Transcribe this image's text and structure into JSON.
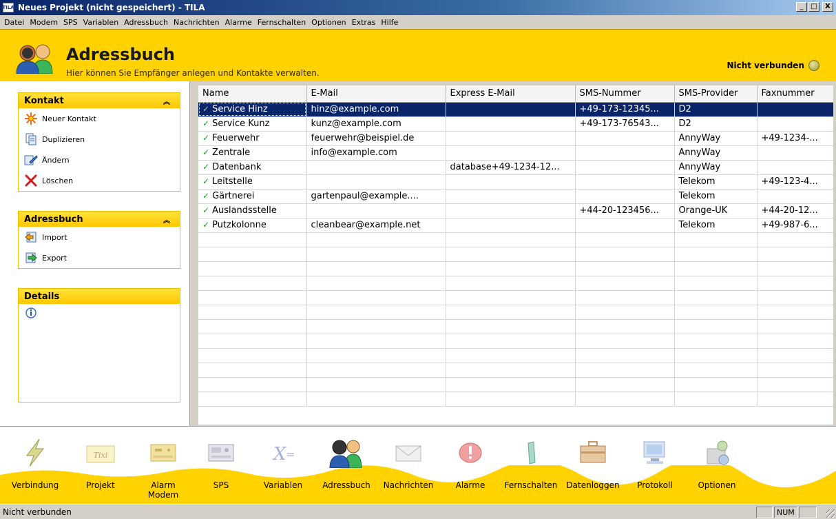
{
  "window": {
    "title": "Neues Projekt (nicht gespeichert) - TILA",
    "app_icon_text": "TILA",
    "minimize": "_",
    "maximize": "□",
    "close": "X"
  },
  "menu": [
    "Datei",
    "Modem",
    "SPS",
    "Variablen",
    "Adressbuch",
    "Nachrichten",
    "Alarme",
    "Fernschalten",
    "Optionen",
    "Extras",
    "Hilfe"
  ],
  "header": {
    "title": "Adressbuch",
    "subtitle": "Hier können Sie Empfänger anlegen und Kontakte verwalten.",
    "connection_status": "Nicht verbunden"
  },
  "sidebar": {
    "kontakt": {
      "title": "Kontakt",
      "items": [
        {
          "label": "Neuer Kontakt",
          "icon": "new-contact-icon"
        },
        {
          "label": "Duplizieren",
          "icon": "duplicate-icon"
        },
        {
          "label": "Ändern",
          "icon": "edit-icon"
        },
        {
          "label": "Löschen",
          "icon": "delete-icon"
        }
      ]
    },
    "adressbuch": {
      "title": "Adressbuch",
      "items": [
        {
          "label": "Import",
          "icon": "import-icon"
        },
        {
          "label": "Export",
          "icon": "export-icon"
        }
      ]
    },
    "details": {
      "title": "Details",
      "icon": "info-icon"
    }
  },
  "table": {
    "columns": [
      "Name",
      "E-Mail",
      "Express E-Mail",
      "SMS-Nummer",
      "SMS-Provider",
      "Faxnummer"
    ],
    "rows": [
      {
        "name": "Service Hinz",
        "email": "hinz@example.com",
        "express": "",
        "sms": "+49-173-12345...",
        "provider": "D2",
        "fax": "",
        "selected": true
      },
      {
        "name": "Service Kunz",
        "email": "kunz@example.com",
        "express": "",
        "sms": "+49-173-76543...",
        "provider": "D2",
        "fax": "",
        "selected": false
      },
      {
        "name": "Feuerwehr",
        "email": "feuerwehr@beispiel.de",
        "express": "",
        "sms": "",
        "provider": "AnnyWay",
        "fax": "+49-1234-...",
        "selected": false
      },
      {
        "name": "Zentrale",
        "email": "info@example.com",
        "express": "",
        "sms": "",
        "provider": "AnnyWay",
        "fax": "",
        "selected": false
      },
      {
        "name": "Datenbank",
        "email": "",
        "express": "database+49-1234-12...",
        "sms": "",
        "provider": "AnnyWay",
        "fax": "",
        "selected": false
      },
      {
        "name": "Leitstelle",
        "email": "",
        "express": "",
        "sms": "",
        "provider": "Telekom",
        "fax": "+49-123-4...",
        "selected": false
      },
      {
        "name": "Gärtnerei",
        "email": "gartenpaul@example....",
        "express": "",
        "sms": "",
        "provider": "Telekom",
        "fax": "",
        "selected": false
      },
      {
        "name": "Auslandsstelle",
        "email": "",
        "express": "",
        "sms": "+44-20-123456...",
        "provider": "Orange-UK",
        "fax": "+44-20-12...",
        "selected": false
      },
      {
        "name": "Putzkolonne",
        "email": "cleanbear@example.net",
        "express": "",
        "sms": "",
        "provider": "Telekom",
        "fax": "+49-987-6...",
        "selected": false
      }
    ],
    "empty_rows": 12
  },
  "bottom_nav": [
    {
      "label": "Verbindung",
      "icon": "lightning-icon",
      "active": false
    },
    {
      "label": "Projekt",
      "icon": "tixi-project-icon",
      "active": false
    },
    {
      "label": "Alarm Modem",
      "icon": "alarm-modem-icon",
      "active": false
    },
    {
      "label": "SPS",
      "icon": "plc-icon",
      "active": false
    },
    {
      "label": "Variablen",
      "icon": "variables-icon",
      "active": false
    },
    {
      "label": "Adressbuch",
      "icon": "address-book-icon",
      "active": true
    },
    {
      "label": "Nachrichten",
      "icon": "envelope-icon",
      "active": false
    },
    {
      "label": "Alarme",
      "icon": "alarm-icon",
      "active": false
    },
    {
      "label": "Fernschalten",
      "icon": "remote-switch-icon",
      "active": false
    },
    {
      "label": "Datenloggen",
      "icon": "briefcase-icon",
      "active": false
    },
    {
      "label": "Protokoll",
      "icon": "monitor-icon",
      "active": false
    },
    {
      "label": "Optionen",
      "icon": "options-icon",
      "active": false
    }
  ],
  "statusbar": {
    "text": "Nicht verbunden",
    "num": "NUM"
  },
  "colors": {
    "accent_yellow": "#ffd200",
    "selection": "#0a246a",
    "check_green": "#1aa31a"
  }
}
